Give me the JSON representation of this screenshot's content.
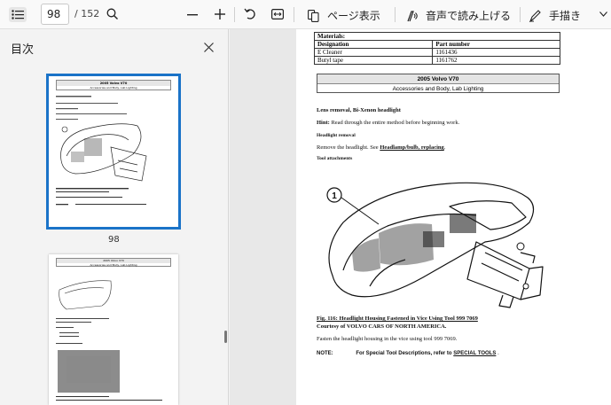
{
  "toolbar": {
    "page_current": "98",
    "page_total": "/ 152",
    "page_view_label": "ページ表示",
    "read_aloud_label": "音声で読み上げる",
    "draw_label": "手描き"
  },
  "sidebar": {
    "title": "目次",
    "thumbnails": [
      {
        "label": "98"
      }
    ]
  },
  "thumb1": {
    "title": "2005 Volvo V70",
    "sub": "Accessories and Body, Lab Lighting"
  },
  "thumb2": {
    "title": "2005 Volvo V70",
    "sub": "Accessories and Body, Lab Lighting"
  },
  "document": {
    "materials_table": {
      "header": "Materials:",
      "columns": [
        "Designation",
        "Part number"
      ],
      "rows": [
        [
          "E Cleaner",
          "1161436"
        ],
        [
          "Butyl tape",
          "1161762"
        ]
      ]
    },
    "header_title": "2005 Volvo V70",
    "header_subtitle": "Accessories and Body, Lab Lighting",
    "section_title": "Lens removal, Bi-Xenon headlight",
    "hint_label": "Hint:",
    "hint_text": "Read through the entire method before beginning work.",
    "headlight_removal": "Headlight removal",
    "remove_text_prefix": "Remove the headlight. See",
    "remove_link": "Headlamp/bulb, replacing",
    "remove_text_suffix": ".",
    "tool_attachments": "Tool attachments",
    "figure_callout": "1",
    "figure_caption": "Fig. 116: Headlight Housing Fastened in Vice Using Tool 999 7069",
    "figure_courtesy": "Courtesy of VOLVO CARS OF NORTH AMERICA.",
    "fasten_text": "Fasten the headlight housing in the vice using tool 999 7069.",
    "note_label": "NOTE:",
    "note_text_prefix": "For Special Tool Descriptions, refer to",
    "note_link": "SPECIAL TOOLS",
    "note_text_suffix": "."
  }
}
